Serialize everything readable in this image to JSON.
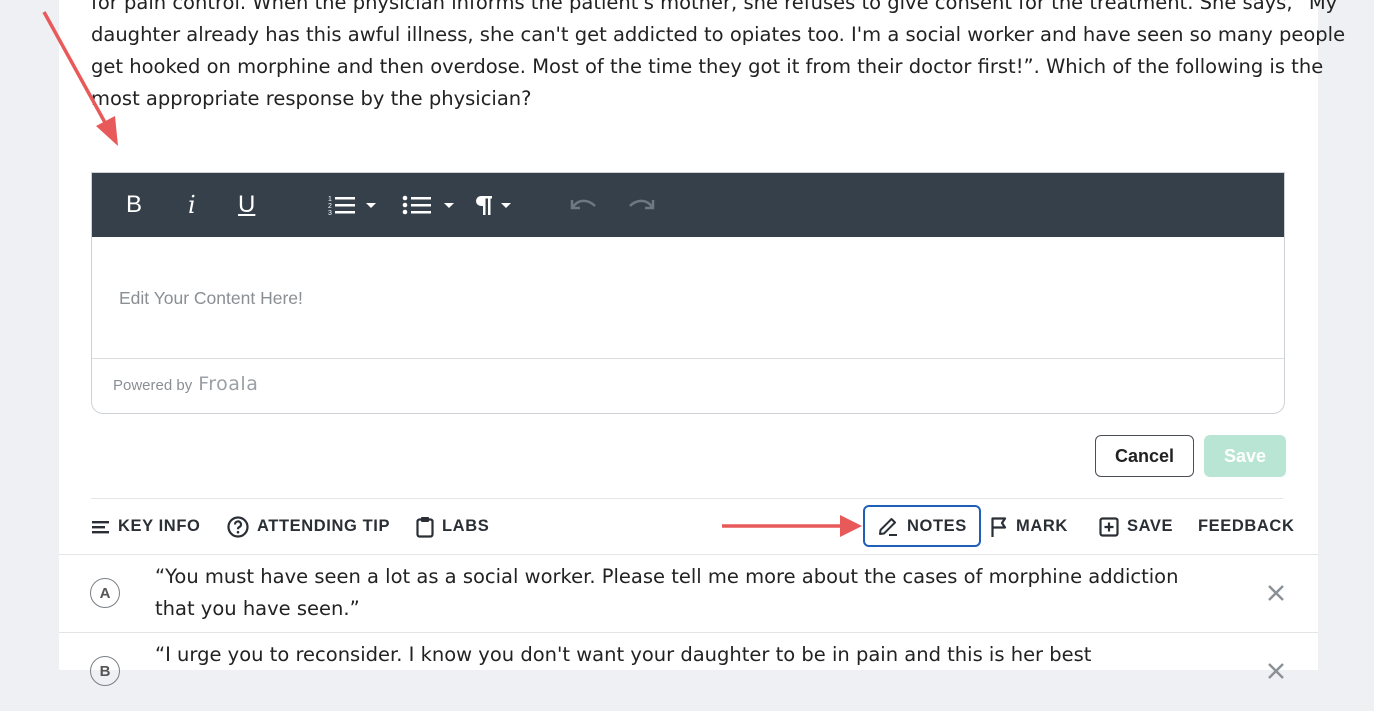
{
  "question": {
    "lines": [
      "for pain control. When the physician informs the patient's mother, she refuses to give consent for the treatment. She says, “My",
      "daughter already has this awful illness, she can't get addicted to opiates too. I'm a social worker and have seen so many people",
      "get hooked on morphine and then overdose. Most of the time they got it from their doctor first!”. Which of the following is the",
      "most appropriate response by the physician?"
    ]
  },
  "editor": {
    "toolbar": {
      "bold_label": "B",
      "italic_label": "i",
      "underline_label": "U"
    },
    "placeholder": "Edit Your Content Here!",
    "powered_by_label": "Powered by",
    "brand": "Froala"
  },
  "buttons": {
    "cancel_label": "Cancel",
    "save_label": "Save"
  },
  "actions": {
    "key_info": "KEY INFO",
    "attending_tip": "ATTENDING TIP",
    "labs": "LABS",
    "notes": "NOTES",
    "mark": "MARK",
    "save": "SAVE",
    "feedback": "FEEDBACK"
  },
  "options": [
    {
      "letter": "A",
      "lines": [
        "“You must have seen a lot as a social worker. Please tell me more about the cases of morphine addiction",
        "that you have seen.”"
      ]
    },
    {
      "letter": "B",
      "lines": [
        "“I urge you to reconsider. I know you don't want your daughter to be in pain and this is her best"
      ]
    }
  ],
  "colors": {
    "toolbar_bg": "#35404a",
    "accent_blue": "#1f5fb8",
    "save_disabled": "#b9e6d4",
    "annotation_arrow": "#e8595a"
  }
}
